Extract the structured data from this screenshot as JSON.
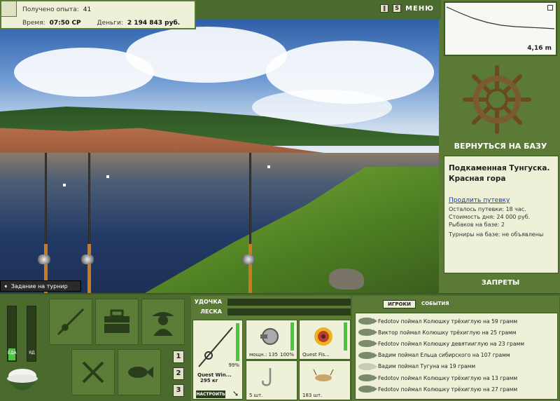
{
  "stats": {
    "experience_label": "Получено опыта:",
    "experience_value": "41",
    "time_label": "Время:",
    "time_value": "07:50 СР",
    "money_label": "Деньги:",
    "money_value": "2 194 843 руб."
  },
  "top_controls": {
    "pause_icon": "pause-icon",
    "sound_label": "S",
    "menu_label": "МЕНЮ"
  },
  "depth": {
    "value": "4,16 m"
  },
  "task": {
    "label": "Задание на турнир"
  },
  "base": {
    "return_label": "ВЕРНУТЬСЯ НА БАЗУ",
    "location": "Подкаменная Тунгуска. Красная гора",
    "extend_link": "Продлить путевку",
    "remaining": "Осталось путевки: 18 час.",
    "day_cost": "Стоимость дня: 24 000 руб.",
    "fishers": "Рыбаков на базе: 2",
    "tournaments": "Турниры на базе: не объявлены",
    "bans_label": "ЗАПРЕТЫ"
  },
  "meters": {
    "food_label": "ЕДА",
    "poison_label": "ЯД",
    "food_level": 0.22,
    "poison_level": 0.0
  },
  "slots": {
    "one": "1",
    "two": "2",
    "three": "3"
  },
  "tackle": {
    "rod_label": "УДОЧКА",
    "line_label": "ЛЕСКА",
    "rod_name": "Quest Win...",
    "rod_weight": "295 кг",
    "rod_condition": "99%",
    "setup_button": "НАСТРОИТЬ",
    "reel_label": "мощн.: 135",
    "reel_condition": "100%",
    "line_name": "Quest Fis...",
    "hooks_count": "5 шт.",
    "bait_count": "183 шт."
  },
  "feed": {
    "tabs": [
      "ИГРОКИ",
      "СОБЫТИЯ"
    ],
    "items": [
      "Fedotov поймал Колюшку трёхиглую на 59 грамм",
      "Виктор поймал Колюшку трёхиглую на 25 грамм",
      "Fedotov поймал Колюшку девятииглую на 23 грамм",
      "Вадим поймал Ельца сибирского на 107 грамм",
      "Вадим поймал Тугуна на 19 грамм",
      "Fedotov поймал Колюшку трёхиглую на 13 грамм",
      "Fedotov поймал Колюшку трёхиглую на 27 грамм"
    ]
  },
  "colors": {
    "panel": "#5a7a36",
    "paper": "#eef0d8",
    "accent": "#47c83a"
  }
}
